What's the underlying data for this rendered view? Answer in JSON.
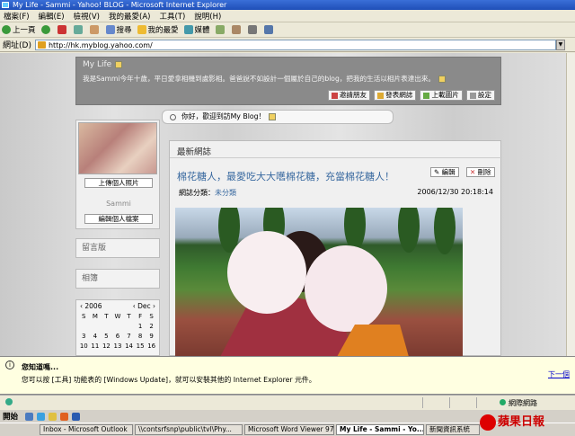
{
  "window": {
    "title": "My Life - Sammi - Yahoo! BLOG - Microsoft Internet Explorer"
  },
  "menu": [
    "檔案(F)",
    "編輯(E)",
    "檢視(V)",
    "我的最愛(A)",
    "工具(T)",
    "說明(H)"
  ],
  "toolbar": {
    "back": "上一頁",
    "search": "搜尋",
    "favorites": "我的最愛",
    "media": "媒體"
  },
  "address": {
    "label": "網址(D)",
    "url": "http://hk.myblog.yahoo.com/"
  },
  "blog": {
    "title": "My Life",
    "description": "我是Sammi今年十歲，平日愛拿相機到處影相。爸爸說不如設計一個屬於自己的blog，把我的生活以相片表達出來。",
    "header_buttons": [
      "邀請朋友",
      "發表網誌",
      "上載圖片",
      "設定"
    ],
    "greeting": "你好，歡迎到訪My Blog！",
    "profile": {
      "upload_photo": "上傳個人照片",
      "name": "Sammi",
      "edit_profile": "編輯個人檔案"
    },
    "sidebar": {
      "guestbook": "留言版",
      "album": "相簿"
    },
    "calendar": {
      "prev": "‹ 2006",
      "next": "‹ Dec ›",
      "weekdays": [
        "S",
        "M",
        "T",
        "W",
        "T",
        "F",
        "S"
      ],
      "rows": [
        [
          "",
          "",
          "",
          "",
          "",
          "1",
          "2"
        ],
        [
          "3",
          "4",
          "5",
          "6",
          "7",
          "8",
          "9"
        ],
        [
          "10",
          "11",
          "12",
          "13",
          "14",
          "15",
          "16"
        ]
      ]
    },
    "section_title": "最新網誌",
    "post": {
      "title": "棉花糖人，最愛吃大大嚿棉花糖，充當棉花糖人！",
      "edit": "編輯",
      "delete": "刪除",
      "category_label": "網誌分類：",
      "category": "未分類",
      "date": "2006/12/30 20:18:14"
    }
  },
  "notification": {
    "title": "您知道嗎...",
    "body": "您可以按 [工具] 功能表的 [Windows Update]，就可以安裝其他的 Internet Explorer 元件。",
    "link": "下一個"
  },
  "status": {
    "zone": "網際網路"
  },
  "quickbar": {
    "start": "開始"
  },
  "taskbar": [
    "Inbox - Microsoft Outlook",
    "\\\\contsrfsnp\\public\\tvl\\Phy...",
    "Microsoft Word Viewer 97...",
    "My Life - Sammi - Yo...",
    "新聞資訊系統"
  ],
  "logo": {
    "text": "蘋果日報"
  },
  "colors": {
    "titlebar": "#1f4fb8",
    "link": "#3a6aa0",
    "header_bg": "#8a8a8a"
  }
}
